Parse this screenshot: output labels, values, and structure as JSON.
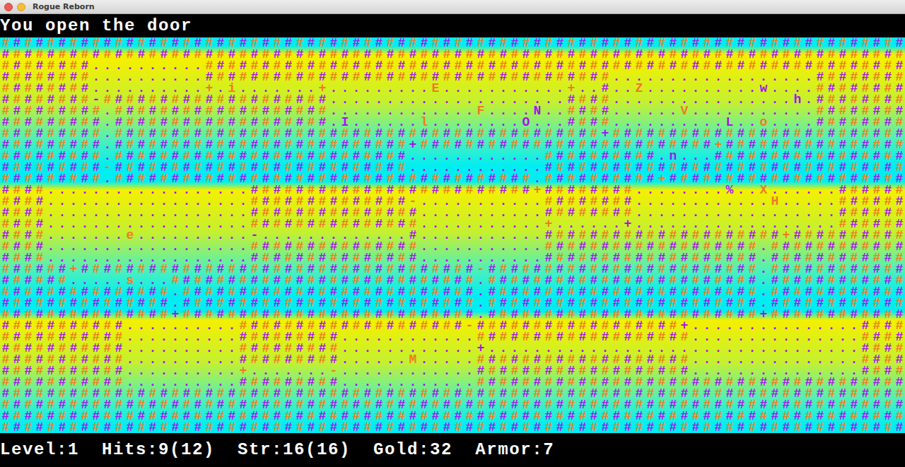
{
  "window": {
    "title": "Rogue Reborn"
  },
  "message": "You open the door",
  "map": {
    "rows": [
      "################################################################################",
      "################################################################################",
      "########..........##############################################################",
      "########..........####################################..................########",
      "########..........+.i.......+.........E...........+..#..Z..........w....########",
      "########-####################.....................####................h.########",
      "#########.###################.............F....N..####......V...........########",
      "#########.###################.I......l........O...####..........L..o....########",
      "#########.###########################################+##########################",
      "#########.##########################+##########################+################",
      "#########.##########################............##########.n...#################",
      "#########-##########################............################################",
      "#########.#####################################.##########+#####################",
      "####..................#########################+########........%..X......######",
      "####..................##############-...........########............H.....######",
      "####..................###############...........########..................######",
      "####..................###############...........+......+..................######",
      "####.......e..........-.............#...........#####################+##########",
      "####..................###############...........###################.############",
      "####..................###############...........###################.############",
      "######+###################################-########################.############",
      "######.....s...###########################.########################.############",
      "###############.##########################.########################.############",
      "###############.##########################.########################.############",
      "###############+##########################.########################+############",
      "###########..........####################-##################+...............####",
      "###########..........#########............###################...............####",
      "###########..........#########............+.................................####",
      "###########..........#########......M.....###################...............####",
      "###########..........+.......-............###################...............####",
      "###########..........#########............######################################",
      "################################################################################",
      "################################################################################",
      "################################################################################",
      "################################################################################"
    ]
  },
  "status_bar": [
    "Level:1",
    "Hits:9(12)",
    "Str:16(16)",
    "Gold:32",
    "Armor:7"
  ]
}
